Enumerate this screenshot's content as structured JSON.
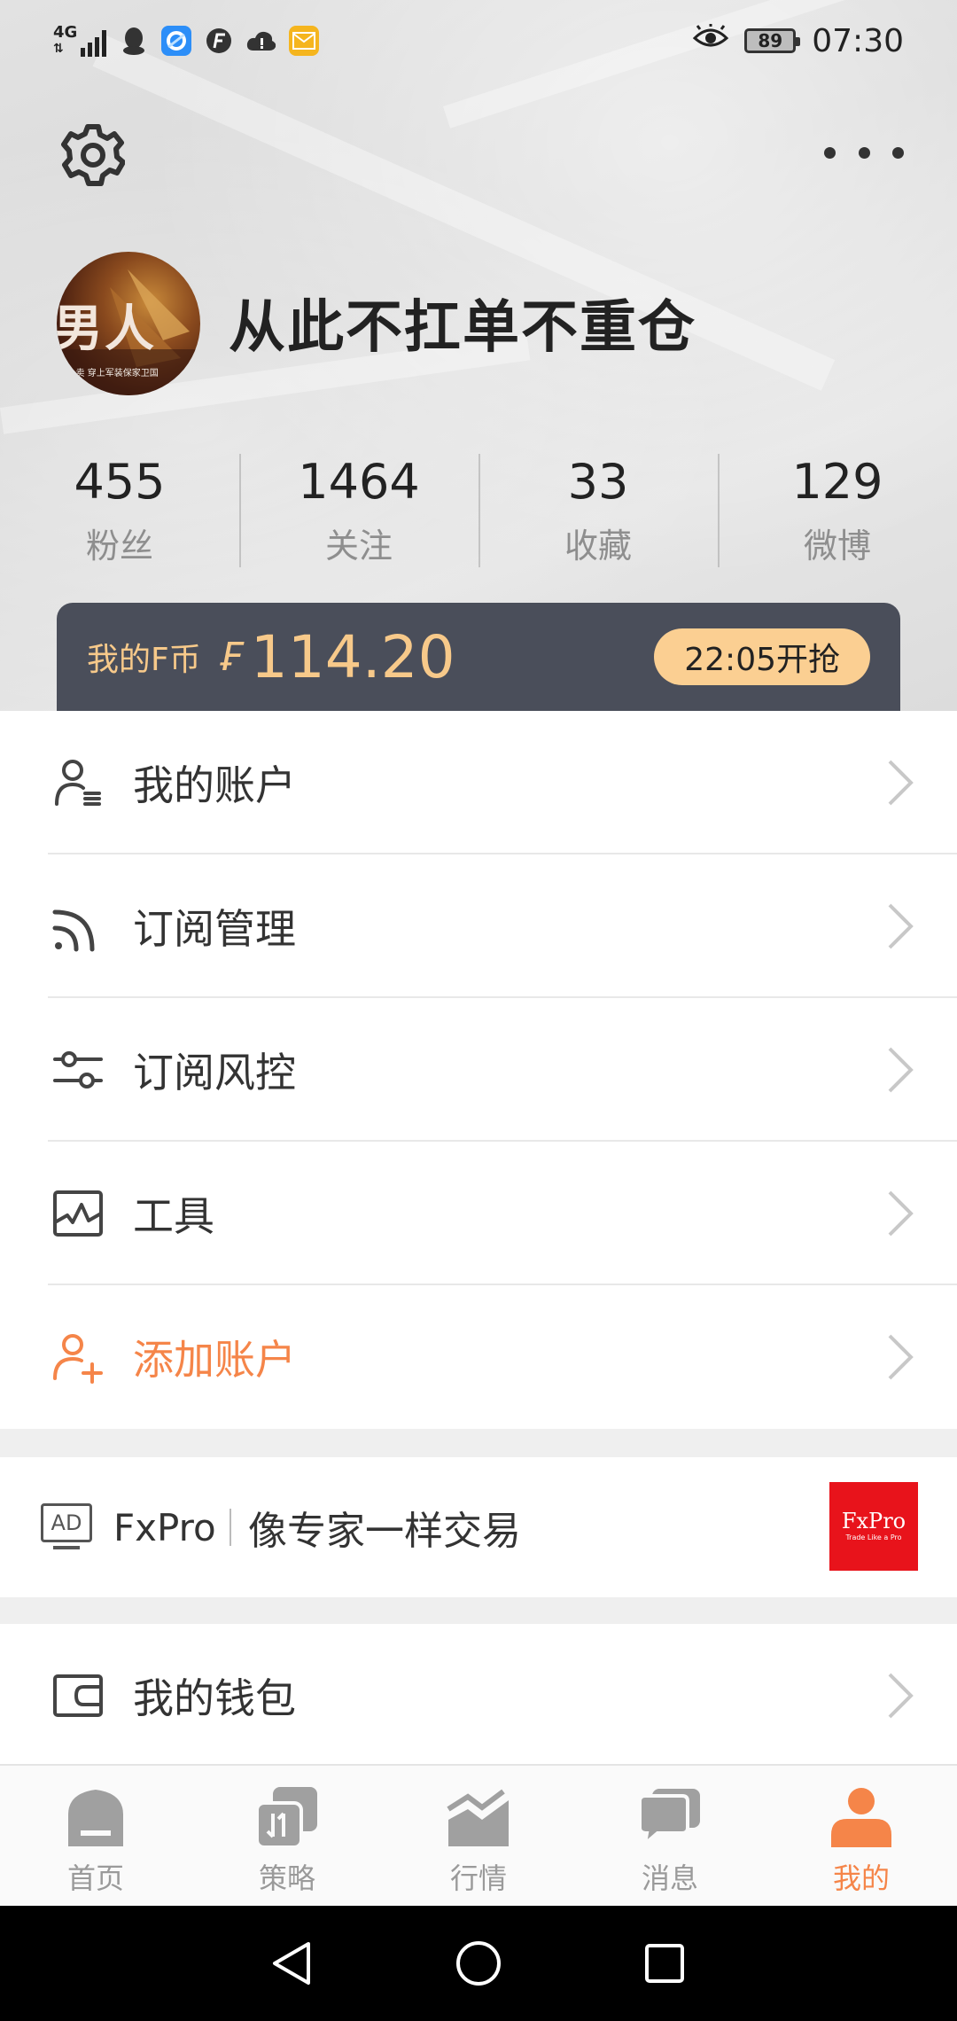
{
  "status_bar": {
    "network": "4G",
    "battery": "89",
    "time": "07:30"
  },
  "profile": {
    "avatar_text": "男人",
    "avatar_caption": "...卖 穿上军装保家卫国",
    "username": "从此不扛单不重仓"
  },
  "stats": [
    {
      "value": "455",
      "label": "粉丝"
    },
    {
      "value": "1464",
      "label": "关注"
    },
    {
      "value": "33",
      "label": "收藏"
    },
    {
      "value": "129",
      "label": "微博"
    }
  ],
  "fcoin": {
    "label": "我的F币",
    "symbol": "₣",
    "amount": "114.20",
    "button": "22:05开抢"
  },
  "menu": [
    {
      "label": "我的账户",
      "icon": "user-list-icon"
    },
    {
      "label": "订阅管理",
      "icon": "rss-icon"
    },
    {
      "label": "订阅风控",
      "icon": "sliders-icon"
    },
    {
      "label": "工具",
      "icon": "chart-pulse-icon"
    },
    {
      "label": "添加账户",
      "icon": "add-user-icon",
      "accent": "#f58549"
    }
  ],
  "ad": {
    "badge": "AD",
    "brand": "FxPro",
    "text": "像专家一样交易",
    "logo_title": "FxPro",
    "logo_sub": "Trade Like a Pro"
  },
  "wallet": {
    "label": "我的钱包",
    "icon": "wallet-icon"
  },
  "tabs": [
    {
      "label": "首页",
      "icon": "home-icon"
    },
    {
      "label": "策略",
      "icon": "strategy-icon"
    },
    {
      "label": "行情",
      "icon": "market-chart-icon"
    },
    {
      "label": "消息",
      "icon": "message-icon"
    },
    {
      "label": "我的",
      "icon": "profile-icon",
      "active": true
    }
  ],
  "colors": {
    "accent": "#f58549",
    "card_bg": "#4a4e5a",
    "gold": "#f7c98a",
    "ad_red": "#e8131b"
  }
}
